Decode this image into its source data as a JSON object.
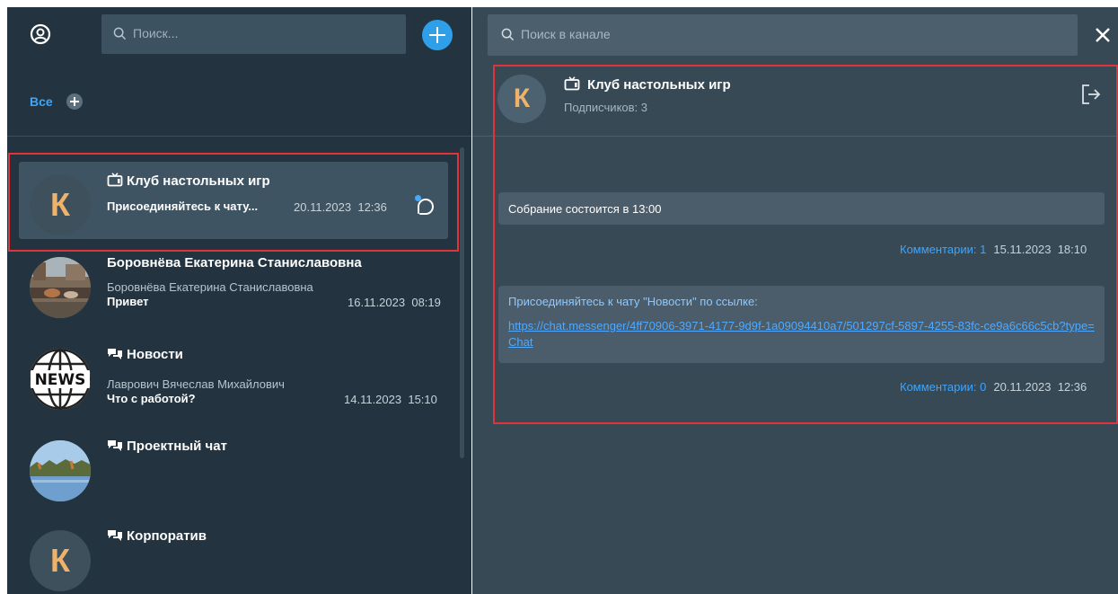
{
  "sidebar": {
    "search_placeholder": "Поиск...",
    "filter_all": "Все",
    "chats": [
      {
        "title": "Клуб настольных игр",
        "type_icon": "tv-channel-icon",
        "avatar_letter": "К",
        "last_message": "Присоединяйтесь к чату...",
        "date": "20.11.2023",
        "time": "12:36",
        "selected": true
      },
      {
        "title": "Боровнёва Екатерина Станиславовна",
        "sender": "Боровнёва Екатерина Станиславовна",
        "last_message": "Привет",
        "date": "16.11.2023",
        "time": "08:19"
      },
      {
        "title": "Новости",
        "type_icon": "group-chat-icon",
        "avatar_text": "NEWS",
        "sender": "Лаврович Вячеслав Михайлович",
        "last_message": "Что с работой?",
        "date": "14.11.2023",
        "time": "15:10"
      },
      {
        "title": "Проектный чат",
        "type_icon": "group-chat-icon"
      },
      {
        "title": "Корпоратив",
        "type_icon": "group-chat-icon",
        "avatar_letter": "К"
      }
    ]
  },
  "channel": {
    "search_placeholder": "Поиск в канале",
    "avatar_letter": "К",
    "title": "Клуб настольных игр",
    "subscribers": "Подписчиков: 3",
    "posts": [
      {
        "text": "Собрание состоится в 13:00",
        "comments": "Комментарии: 1",
        "date": "15.11.2023",
        "time": "18:10"
      },
      {
        "text": "Присоединяйтесь к чату \"Новости\" по ссылке:",
        "link": "https://chat.messenger/4ff70906-3971-4177-9d9f-1a09094410a7/501297cf-5897-4255-83fc-ce9a6c66c5cb?type=Chat",
        "comments": "Комментарии: 0",
        "date": "20.11.2023",
        "time": "12:36"
      }
    ]
  },
  "colors": {
    "sidebar_bg": "#233440",
    "main_bg": "#364955",
    "accent": "#2f9fe8",
    "avatar_letter": "#efb26a",
    "highlight_border": "#e0343a"
  }
}
